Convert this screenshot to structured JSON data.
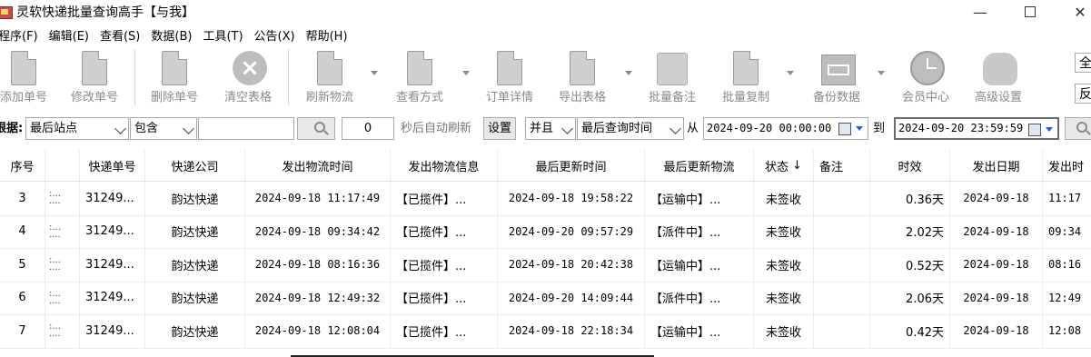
{
  "window": {
    "title": "灵软快递批量查询高手【与我】",
    "min": "—",
    "close": "✕"
  },
  "menu": [
    "程序(F)",
    "编辑(E)",
    "查看(S)",
    "数据(B)",
    "工具(T)",
    "公告(X)",
    "帮助(H)"
  ],
  "toolbar": {
    "add": "添加单号",
    "edit": "修改单号",
    "delete": "删除单号",
    "clear": "清空表格",
    "refresh": "刷新物流",
    "view_mode": "查看方式",
    "order_detail": "订单详情",
    "export": "导出表格",
    "batch_note": "批量备注",
    "batch_copy": "批量复制",
    "backup": "备份数据",
    "member": "会员中心",
    "advanced": "高级设置",
    "edge_top": "全",
    "edge_bottom": "反"
  },
  "filter": {
    "label": "根据:",
    "field": "最后站点",
    "op": "包含",
    "keyword": "",
    "interval": "0",
    "auto_refresh_label": "秒后自动刷新",
    "set_button": "设置",
    "logic": "并且",
    "time_field": "最后查询时间",
    "from_label": "从",
    "from": "2024-09-20 00:00:00",
    "to_label": "到",
    "to": "2024-09-20 23:59:59"
  },
  "table": {
    "columns": [
      "序号",
      "",
      "快递单号",
      "快递公司",
      "发出物流时间",
      "发出物流信息",
      "最后更新时间",
      "最后更新物流",
      "状态",
      "备注",
      "时效",
      "发出日期",
      "发出时"
    ],
    "sort_indicator": "↓",
    "rows": [
      {
        "no": "3",
        "tn": "31249...",
        "co": "韵达快递",
        "st": "2024-09-18 11:17:49",
        "si": "【已揽件】...",
        "lt": "2024-09-18 19:58:22",
        "li": "【运输中】...",
        "status": "未签收",
        "note": "",
        "eff": "0.36天",
        "date": "2024-09-18",
        "time": "11:17"
      },
      {
        "no": "4",
        "tn": "31249...",
        "co": "韵达快递",
        "st": "2024-09-18 09:34:42",
        "si": "【已揽件】...",
        "lt": "2024-09-20 09:57:29",
        "li": "【派件中】...",
        "status": "未签收",
        "note": "",
        "eff": "2.02天",
        "date": "2024-09-18",
        "time": "09:34"
      },
      {
        "no": "5",
        "tn": "31249...",
        "co": "韵达快递",
        "st": "2024-09-18 08:16:36",
        "si": "【已揽件】...",
        "lt": "2024-09-18 20:42:38",
        "li": "【运输中】...",
        "status": "未签收",
        "note": "",
        "eff": "0.52天",
        "date": "2024-09-18",
        "time": "08:16"
      },
      {
        "no": "6",
        "tn": "31249...",
        "co": "韵达快递",
        "st": "2024-09-18 12:49:32",
        "si": "【已揽件】...",
        "lt": "2024-09-20 14:09:44",
        "li": "【派件中】...",
        "status": "未签收",
        "note": "",
        "eff": "2.06天",
        "date": "2024-09-18",
        "time": "12:49"
      },
      {
        "no": "7",
        "tn": "31249...",
        "co": "韵达快递",
        "st": "2024-09-18 12:08:04",
        "si": "【已揽件】...",
        "lt": "2024-09-18 22:18:34",
        "li": "【运输中】...",
        "status": "未签收",
        "note": "",
        "eff": "0.42天",
        "date": "2024-09-18",
        "time": "12:08"
      }
    ]
  }
}
